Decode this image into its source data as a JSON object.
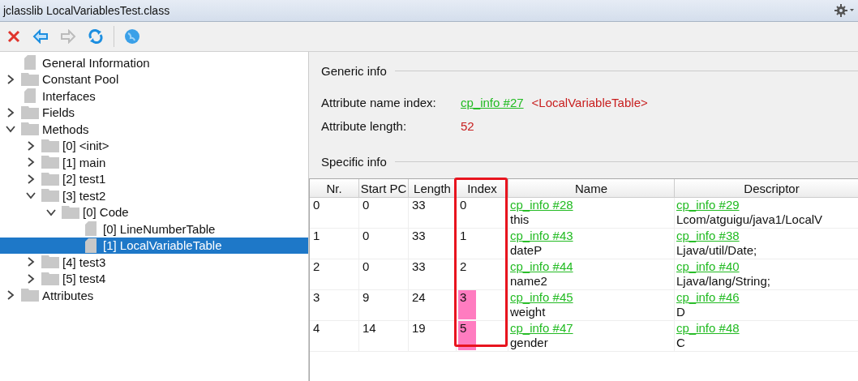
{
  "window": {
    "title": "jclasslib LocalVariablesTest.class"
  },
  "toolbar": [
    {
      "kind": "close",
      "disabled": false
    },
    {
      "kind": "back",
      "disabled": false
    },
    {
      "kind": "forward",
      "disabled": true
    },
    {
      "kind": "refresh",
      "disabled": false
    },
    {
      "kind": "web",
      "disabled": false
    }
  ],
  "tree": [
    {
      "label": "General Information",
      "kind": "file",
      "selected": false
    },
    {
      "label": "Constant Pool",
      "kind": "folder",
      "expanded": false,
      "selected": false
    },
    {
      "label": "Interfaces",
      "kind": "file",
      "selected": false
    },
    {
      "label": "Fields",
      "kind": "folder",
      "expanded": false,
      "selected": false
    },
    {
      "label": "Methods",
      "kind": "folder",
      "expanded": true,
      "selected": false,
      "children": [
        {
          "label": "[0] <init>",
          "kind": "folder",
          "expanded": false,
          "selected": false
        },
        {
          "label": "[1] main",
          "kind": "folder",
          "expanded": false,
          "selected": false
        },
        {
          "label": "[2] test1",
          "kind": "folder",
          "expanded": false,
          "selected": false
        },
        {
          "label": "[3] test2",
          "kind": "folder",
          "expanded": true,
          "selected": false,
          "children": [
            {
              "label": "[0] Code",
              "kind": "folder",
              "expanded": true,
              "selected": false,
              "children": [
                {
                  "label": "[0] LineNumberTable",
                  "kind": "file",
                  "selected": false
                },
                {
                  "label": "[1] LocalVariableTable",
                  "kind": "file",
                  "selected": true
                }
              ]
            }
          ]
        },
        {
          "label": "[4] test3",
          "kind": "folder",
          "expanded": false,
          "selected": false
        },
        {
          "label": "[5] test4",
          "kind": "folder",
          "expanded": false,
          "selected": false
        }
      ]
    },
    {
      "label": "Attributes",
      "kind": "folder",
      "expanded": false,
      "selected": false
    }
  ],
  "generic_info": {
    "heading": "Generic info",
    "name_index_label": "Attribute name index:",
    "name_index_link": "cp_info #27",
    "name_index_value": "<LocalVariableTable>",
    "length_label": "Attribute length:",
    "length_value": "52"
  },
  "specific_info": {
    "heading": "Specific info",
    "columns": [
      {
        "label": "Nr.",
        "outlined": false
      },
      {
        "label": "Start PC",
        "outlined": false
      },
      {
        "label": "Length",
        "outlined": false
      },
      {
        "label": "Index",
        "outlined": true
      },
      {
        "label": "Name",
        "outlined": false
      },
      {
        "label": "Descriptor",
        "outlined": false
      }
    ],
    "rows": [
      {
        "nr": "0",
        "start_pc": "0",
        "length": "33",
        "index": "0",
        "highlighted": false,
        "name_link": "cp_info #28",
        "name": "this",
        "descriptor_link": "cp_info #29",
        "descriptor": "Lcom/atguigu/java1/LocalV"
      },
      {
        "nr": "1",
        "start_pc": "0",
        "length": "33",
        "index": "1",
        "highlighted": false,
        "name_link": "cp_info #43",
        "name": "dateP",
        "descriptor_link": "cp_info #38",
        "descriptor": "Ljava/util/Date;"
      },
      {
        "nr": "2",
        "start_pc": "0",
        "length": "33",
        "index": "2",
        "highlighted": false,
        "name_link": "cp_info #44",
        "name": "name2",
        "descriptor_link": "cp_info #40",
        "descriptor": "Ljava/lang/String;"
      },
      {
        "nr": "3",
        "start_pc": "9",
        "length": "24",
        "index": "3",
        "highlighted": true,
        "name_link": "cp_info #45",
        "name": "weight",
        "descriptor_link": "cp_info #46",
        "descriptor": "D"
      },
      {
        "nr": "4",
        "start_pc": "14",
        "length": "19",
        "index": "5",
        "highlighted": true,
        "name_link": "cp_info #47",
        "name": "gender",
        "descriptor_link": "cp_info #48",
        "descriptor": "C"
      }
    ]
  }
}
